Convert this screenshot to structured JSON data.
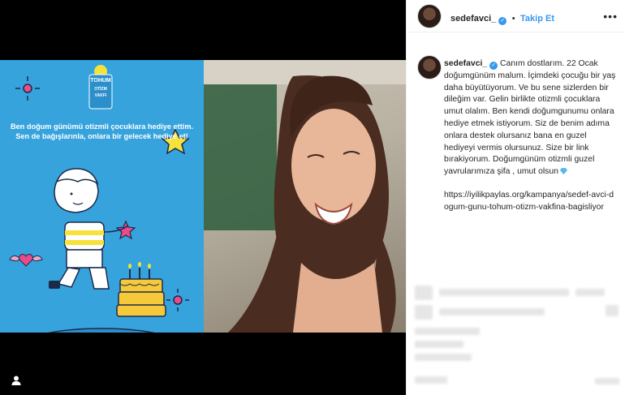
{
  "post_image": {
    "promo": {
      "logo": [
        "TOHUM",
        "OTİZM",
        "VAKFI"
      ],
      "message": "Ben doğum günümü otizmli çocuklara hediye ettim. Sen de bağışlarınla, onlara bir gelecek hediye et!"
    }
  },
  "header": {
    "username": "sedefavci_",
    "separator": "•",
    "follow_label": "Takip Et",
    "more_icon": "more-horizontal-icon"
  },
  "caption": {
    "username": "sedefavci_",
    "text": "Canım dostlarım. 22 Ocak doğumgünüm malum. İçimdeki çocuğu bir yaş daha büyütüyorum. Ve bu sene sizlerden bir dileğim var. Gelin birlikte otizmli çocuklara umut olalım. Ben kendi doğumgunumu onlara hediye etmek istiyorum. Siz de benim adıma onlara destek olursanız bana en guzel hediyeyi vermis olursunuz. Size bir link bırakiyorum. Doğumgünüm otizmli guzel yavrularımıza şifa , umut olsun",
    "link": "https://iyilikpaylas.org/kampanya/sedef-avci-dogum-gunu-tohum-otizm-vakfina-bagisliyor"
  },
  "colors": {
    "promo_bg": "#36a3dd",
    "accent": "#3897f0",
    "text": "#262626"
  }
}
